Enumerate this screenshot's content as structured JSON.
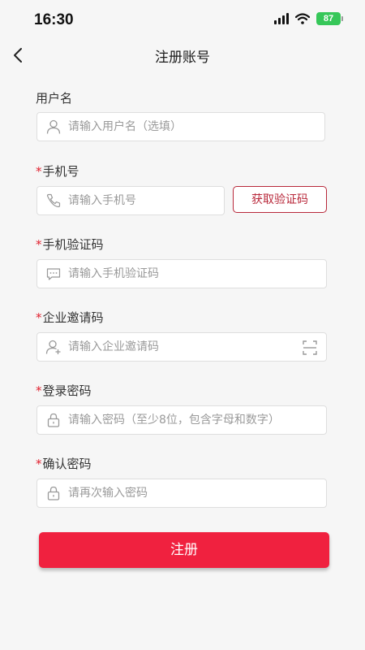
{
  "status_bar": {
    "time": "16:30",
    "battery": "87"
  },
  "nav": {
    "title": "注册账号"
  },
  "fields": {
    "username": {
      "label": "用户名",
      "placeholder": "请输入用户名（选填）"
    },
    "phone": {
      "label": "手机号",
      "placeholder": "请输入手机号"
    },
    "sms_code": {
      "label": "手机验证码",
      "placeholder": "请输入手机验证码"
    },
    "invite_code": {
      "label": "企业邀请码",
      "placeholder": "请输入企业邀请码"
    },
    "password": {
      "label": "登录密码",
      "placeholder": "请输入密码（至少8位，包含字母和数字）"
    },
    "confirm_password": {
      "label": "确认密码",
      "placeholder": "请再次输入密码"
    }
  },
  "required_mark": "*",
  "buttons": {
    "get_code": "获取验证码",
    "register": "注册"
  },
  "icons": {
    "back": "chevron-left-icon",
    "user": "user-icon",
    "phone": "phone-icon",
    "message": "message-icon",
    "add_user": "user-add-icon",
    "scan": "scan-icon",
    "lock": "lock-icon"
  },
  "colors": {
    "accent": "#f0213f",
    "code_button": "#b8283a",
    "required": "#e0202e",
    "background": "#f6f6f6"
  }
}
